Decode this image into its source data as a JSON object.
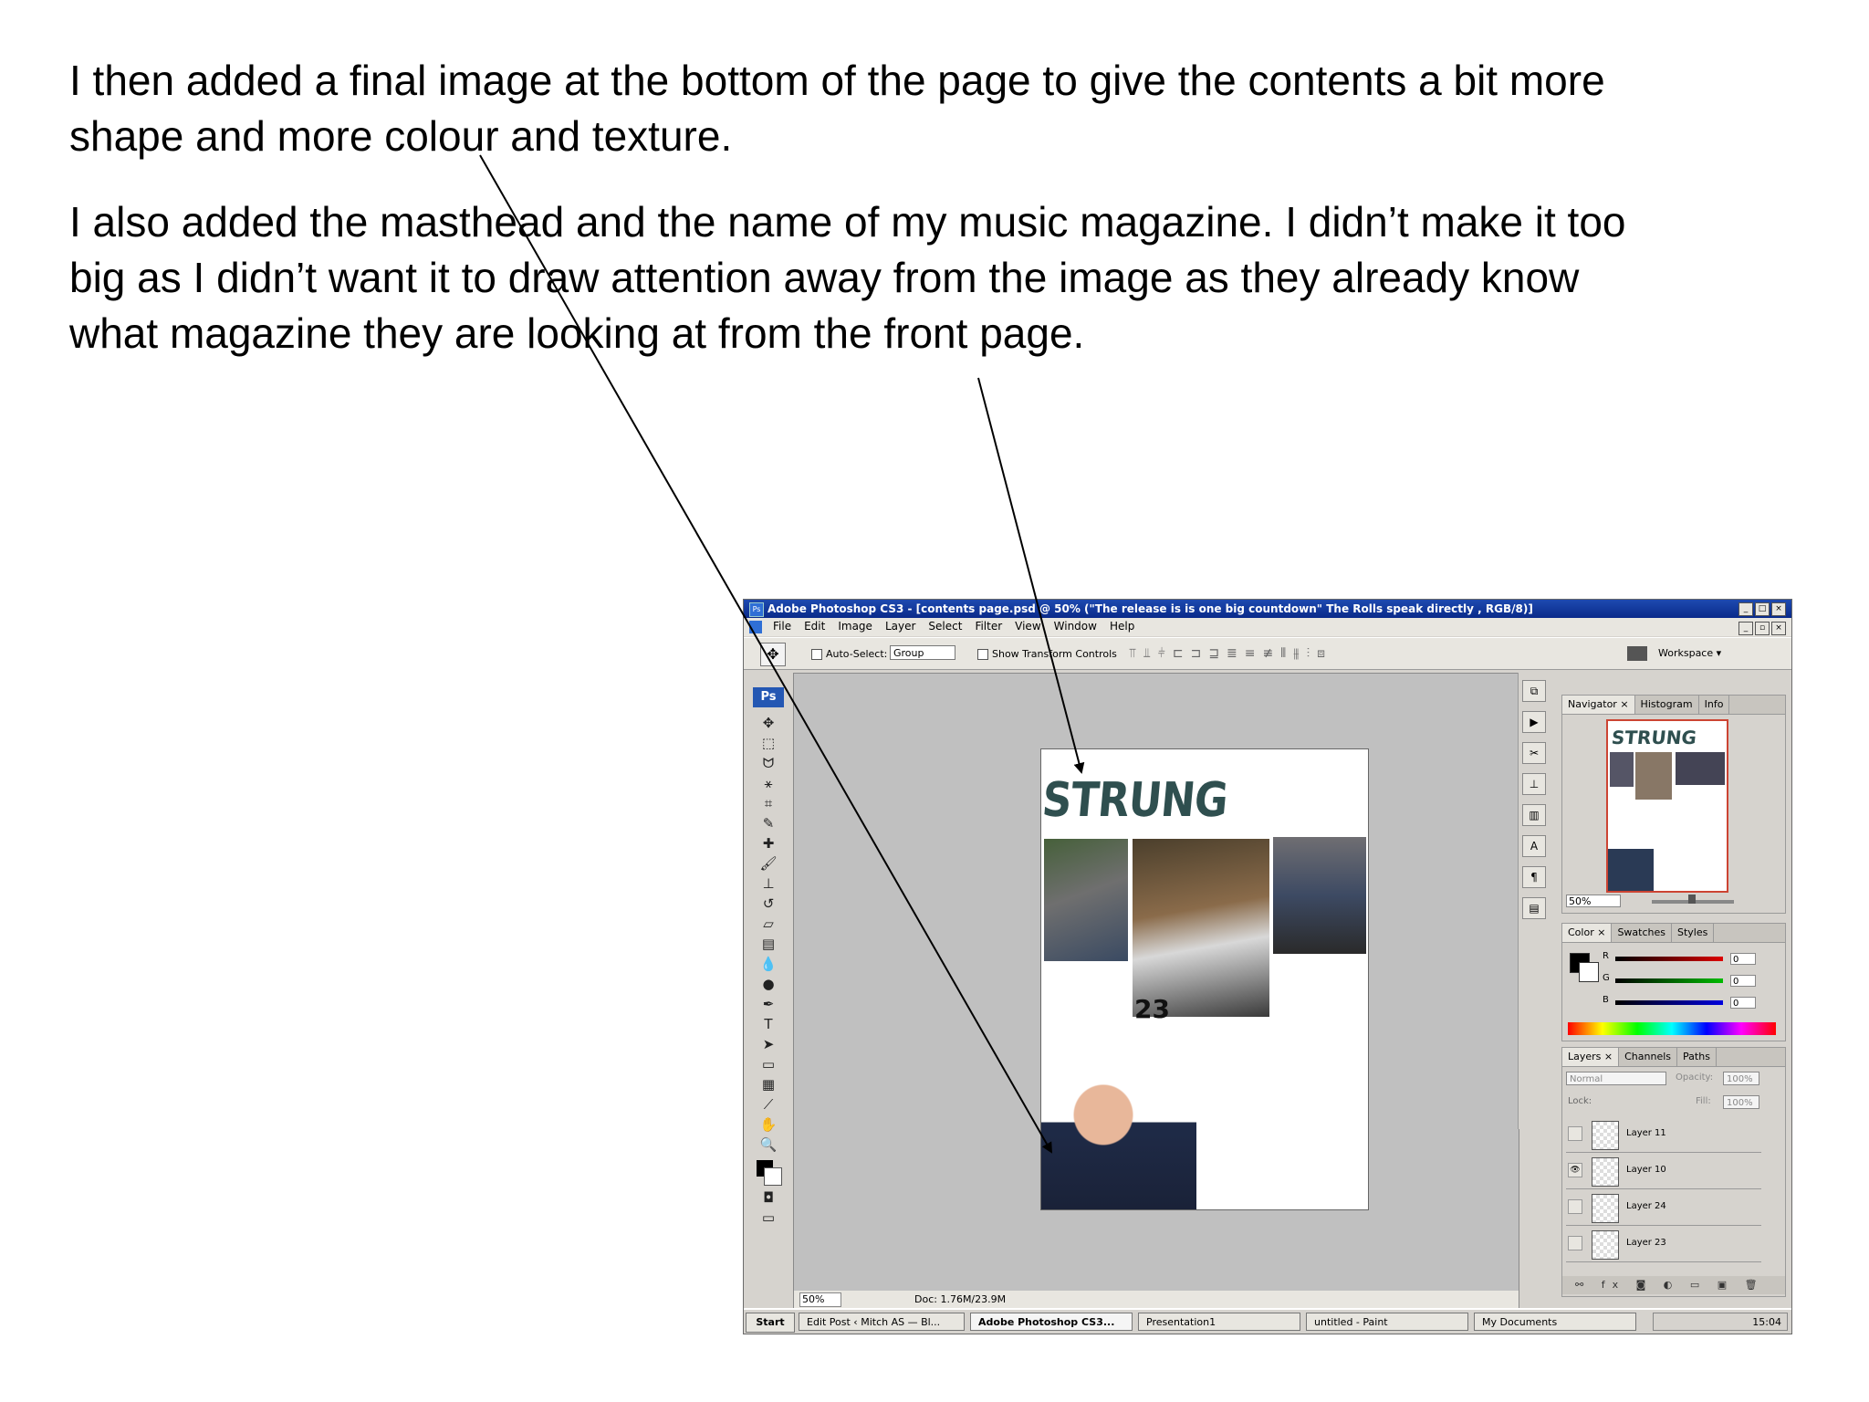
{
  "slide": {
    "paragraph_1": "I then added a final image at the bottom of the page to give the contents a bit more shape and more colour and texture.",
    "paragraph_2": "I also added the masthead and the name of my music magazine. I didn’t make it too big as I didn’t want it to draw attention away from the image as they already know what magazine they are looking at from the front page."
  },
  "photoshop": {
    "title_bar": "Adobe Photoshop CS3 - [contents page.psd @ 50% (\"The release is is one big countdown\" The Rolls speak directly , RGB/8)]",
    "menu": [
      "File",
      "Edit",
      "Image",
      "Layer",
      "Select",
      "Filter",
      "View",
      "Window",
      "Help"
    ],
    "options": {
      "auto_select_label": "Auto-Select:",
      "auto_select_value": "Group",
      "show_transform_label": "Show Transform Controls",
      "workspace_label": "Workspace ▾"
    },
    "tools_logo": "Ps",
    "document": {
      "masthead": "STRUNG",
      "badge": "23"
    },
    "status": {
      "zoom": "50%",
      "doc_info": "Doc: 1.76M/23.9M"
    },
    "navigator": {
      "tabs": [
        "Navigator ×",
        "Histogram",
        "Info"
      ],
      "thumb_masthead": "STRUNG",
      "zoom": "50%"
    },
    "color": {
      "tabs": [
        "Color ×",
        "Swatches",
        "Styles"
      ],
      "r_label": "R",
      "r_value": "0",
      "g_label": "G",
      "g_value": "0",
      "b_label": "B",
      "b_value": "0"
    },
    "layers": {
      "tabs": [
        "Layers ×",
        "Channels",
        "Paths"
      ],
      "blend_mode": "Normal",
      "opacity_label": "Opacity:",
      "opacity_value": "100%",
      "lock_label": "Lock:",
      "fill_label": "Fill:",
      "fill_value": "100%",
      "items": [
        "Layer 11",
        "Layer 10",
        "Layer 24",
        "Layer 23"
      ]
    },
    "taskbar": {
      "start": "Start",
      "tasks": [
        "Edit Post ‹ Mitch AS — Bl...",
        "Adobe Photoshop CS3...",
        "Presentation1",
        "untitled - Paint",
        "My Documents"
      ],
      "clock": "15:04"
    }
  }
}
